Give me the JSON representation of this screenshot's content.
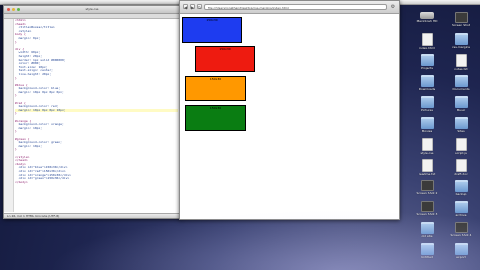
{
  "editor": {
    "title": "style.css",
    "code_lines": [
      "<html>",
      "<head>",
      "  <title>Boxes</title>",
      "  <style>",
      "body {",
      "  margin: 0px;",
      "}",
      "",
      "div {",
      "  width: 60px;",
      "  height: 20px;",
      "  border: 1px solid #000000;",
      "  color: #000;",
      "  font-size: 10px;",
      "  text-align: center;",
      "  line-height: 20px;",
      "}",
      "",
      "#blue {",
      "  background-color: blue;",
      "  margin: 10px 0px 0px 0px;",
      "}",
      "",
      "#red {",
      "  background-color: red;",
      "  margin: 10px 0px 0px 10px;",
      "}",
      "",
      "#orange {",
      "  background-color: orange;",
      "  margin: 10px;",
      "}",
      "",
      "#green {",
      "  background-color: green;",
      "  margin: 10px;",
      "}",
      "",
      "</style>",
      "</head>",
      "<body>",
      "  <div id=\"blue\">150x30</div>",
      "  <div id=\"red\">150x30</div>",
      "  <div id=\"orange\">150x30</div>",
      "  <div id=\"green\">150x30</div>",
      "</body>"
    ],
    "highlight_line": 25,
    "status": "Ln 26, Col 1    HTML    Unicode (UTF-8)"
  },
  "browser": {
    "url": "file:///Users/jonathan/Desktop/css-margins/index.html",
    "back_glyph": "◀",
    "forward_glyph": "▶",
    "reload_glyph": "↻",
    "wrench_glyph": "⚙",
    "boxes": [
      {
        "id": "blue",
        "label": "150x30",
        "color": "#1e3cf0"
      },
      {
        "id": "red",
        "label": "150x30",
        "color": "#ee1b10"
      },
      {
        "id": "orange",
        "label": "150x30",
        "color": "#ff9800"
      },
      {
        "id": "green",
        "label": "150x30",
        "color": "#0a7d12"
      }
    ]
  },
  "desktop": {
    "icons": [
      {
        "label": "Macintosh HD",
        "kind": "drive"
      },
      {
        "label": "Screen Shot",
        "kind": "app"
      },
      {
        "label": "index.html",
        "kind": "doc"
      },
      {
        "label": "css-margins",
        "kind": "folder"
      },
      {
        "label": "Projects",
        "kind": "folder"
      },
      {
        "label": "notes.txt",
        "kind": "doc"
      },
      {
        "label": "Downloads",
        "kind": "folder"
      },
      {
        "label": "Documents",
        "kind": "folder"
      },
      {
        "label": "Pictures",
        "kind": "folder"
      },
      {
        "label": "Music",
        "kind": "folder"
      },
      {
        "label": "Movies",
        "kind": "folder"
      },
      {
        "label": "Sites",
        "kind": "folder"
      },
      {
        "label": "style.css",
        "kind": "doc"
      },
      {
        "label": "script.js",
        "kind": "doc"
      },
      {
        "label": "readme.txt",
        "kind": "doc"
      },
      {
        "label": "draft.doc",
        "kind": "doc"
      },
      {
        "label": "Screen Shot 2",
        "kind": "app"
      },
      {
        "label": "backup",
        "kind": "folder"
      },
      {
        "label": "Screen Shot 3",
        "kind": "app"
      },
      {
        "label": "archive",
        "kind": "folder"
      },
      {
        "label": "old site",
        "kind": "folder"
      },
      {
        "label": "Screen Shot 4",
        "kind": "app"
      },
      {
        "label": "Untitled",
        "kind": "folder"
      },
      {
        "label": "export",
        "kind": "folder"
      }
    ]
  }
}
